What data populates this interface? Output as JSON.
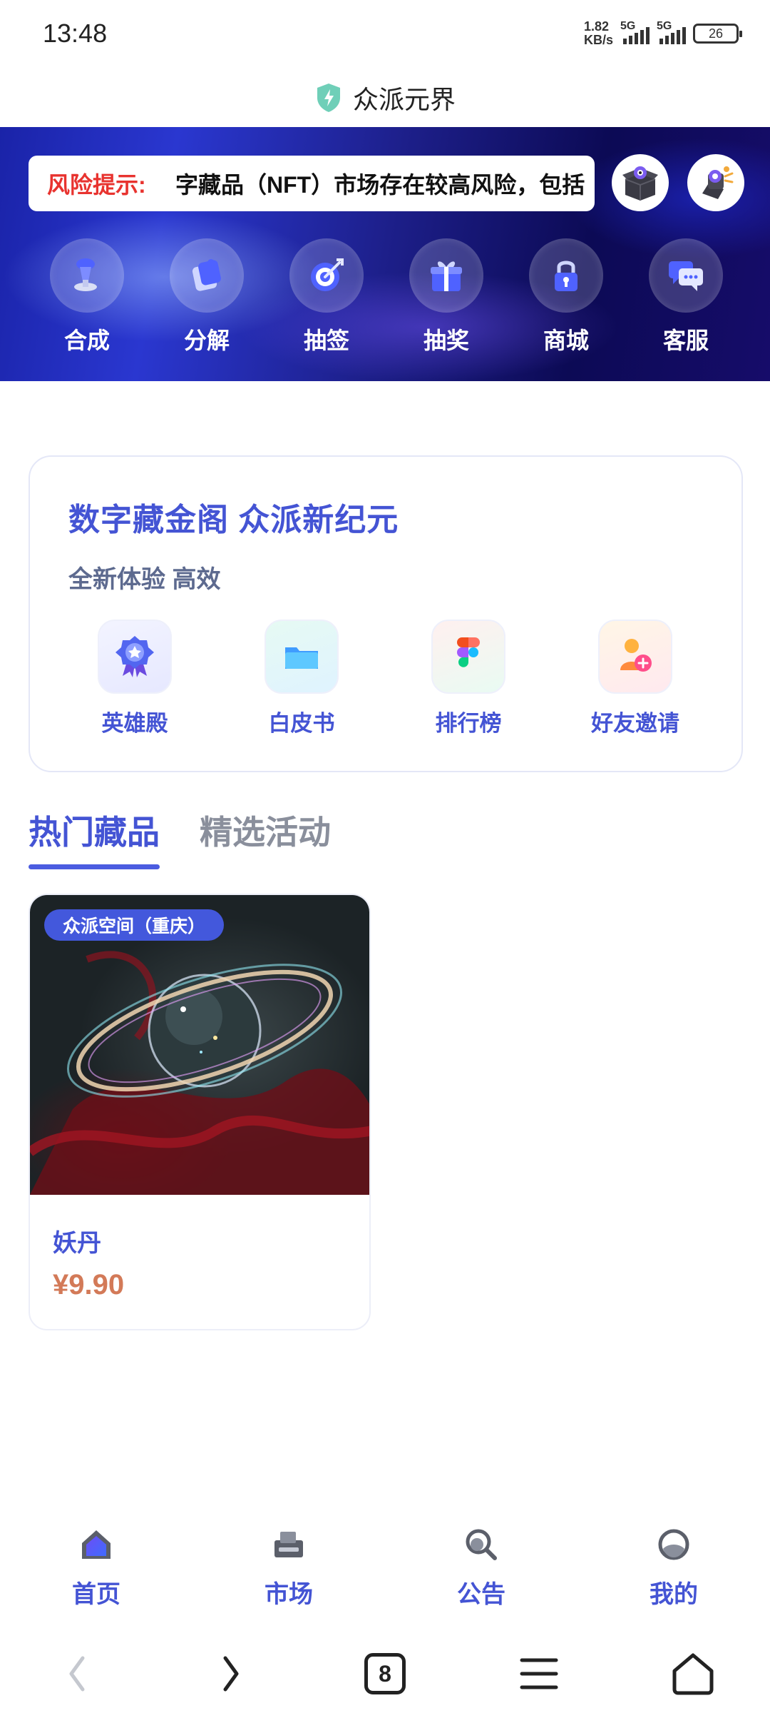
{
  "status_bar": {
    "time": "13:48",
    "net_speed_value": "1.82",
    "net_speed_unit": "KB/s",
    "sim1": "5G",
    "sim2": "5G",
    "battery": "26"
  },
  "app": {
    "title": "众派元界"
  },
  "banner": {
    "notice_label": "风险提示:",
    "notice_text": "字藏品（NFT）市场存在较高风险，包括"
  },
  "quick_actions": [
    {
      "label": "合成",
      "icon": "trophy-icon"
    },
    {
      "label": "分解",
      "icon": "puzzle-icon"
    },
    {
      "label": "抽签",
      "icon": "target-icon"
    },
    {
      "label": "抽奖",
      "icon": "gift-icon"
    },
    {
      "label": "商城",
      "icon": "lock-icon"
    },
    {
      "label": "客服",
      "icon": "chat-icon"
    }
  ],
  "intro": {
    "title": "数字藏金阁 众派新纪元",
    "subtitle": "全新体验 高效",
    "features": [
      {
        "label": "英雄殿",
        "icon": "badge-icon"
      },
      {
        "label": "白皮书",
        "icon": "folder-icon"
      },
      {
        "label": "排行榜",
        "icon": "figma-icon"
      },
      {
        "label": "好友邀请",
        "icon": "invite-icon"
      }
    ]
  },
  "tabs": [
    {
      "label": "热门藏品",
      "active": true
    },
    {
      "label": "精选活动",
      "active": false
    }
  ],
  "products": [
    {
      "tag": "众派空间（重庆）",
      "name": "妖丹",
      "price": "¥9.90"
    }
  ],
  "bottom_nav": [
    {
      "label": "首页",
      "icon": "home-icon"
    },
    {
      "label": "市场",
      "icon": "market-icon"
    },
    {
      "label": "公告",
      "icon": "search-icon"
    },
    {
      "label": "我的",
      "icon": "profile-icon"
    }
  ],
  "system_nav": {
    "tabs_count": "8"
  },
  "colors": {
    "accent": "#4454d4",
    "warning": "#e8332f",
    "price": "#d37a58"
  }
}
